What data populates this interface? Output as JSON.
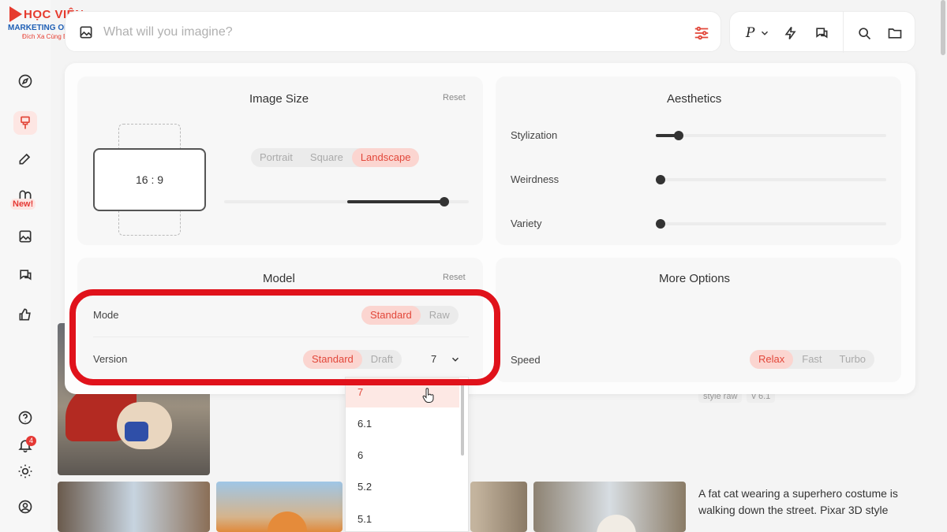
{
  "logo": {
    "line1": "HỌC VIỆN",
    "line2": "MARKETING ONLINE",
    "line3": "Đích Xa Cùng Bạn"
  },
  "prompt": {
    "placeholder": "What will you imagine?"
  },
  "toolbar": {
    "personalize_label": "P"
  },
  "sidebar": {
    "new_badge": "New!",
    "notification_count": "4"
  },
  "image_size": {
    "title": "Image Size",
    "reset": "Reset",
    "ratio": "16 : 9",
    "orientations": [
      "Portrait",
      "Square",
      "Landscape"
    ],
    "selected_orientation": "Landscape"
  },
  "aesthetics": {
    "title": "Aesthetics",
    "sliders": [
      {
        "label": "Stylization",
        "value_fraction": 0.1
      },
      {
        "label": "Weirdness",
        "value_fraction": 0.0
      },
      {
        "label": "Variety",
        "value_fraction": 0.0
      }
    ]
  },
  "model": {
    "title": "Model",
    "reset": "Reset",
    "mode_label": "Mode",
    "mode_options": [
      "Standard",
      "Raw"
    ],
    "version_label": "Version",
    "version_options": [
      "Standard",
      "Draft"
    ],
    "version_value": "7"
  },
  "more_options": {
    "title": "More Options",
    "speed_label": "Speed",
    "speed_options": [
      "Relax",
      "Fast",
      "Turbo"
    ]
  },
  "version_dropdown": {
    "items": [
      "7",
      "6.1",
      "6",
      "5.2",
      "5.1"
    ],
    "selected": "7"
  },
  "gallery": {
    "tags": [
      "style raw",
      "v 6.1"
    ],
    "caption": "A fat cat wearing a superhero costume is walking down the street. Pixar 3D style"
  },
  "colors": {
    "accent": "#e2473a",
    "accent_bg": "#fbd5d0",
    "annotation": "#e0121b"
  }
}
